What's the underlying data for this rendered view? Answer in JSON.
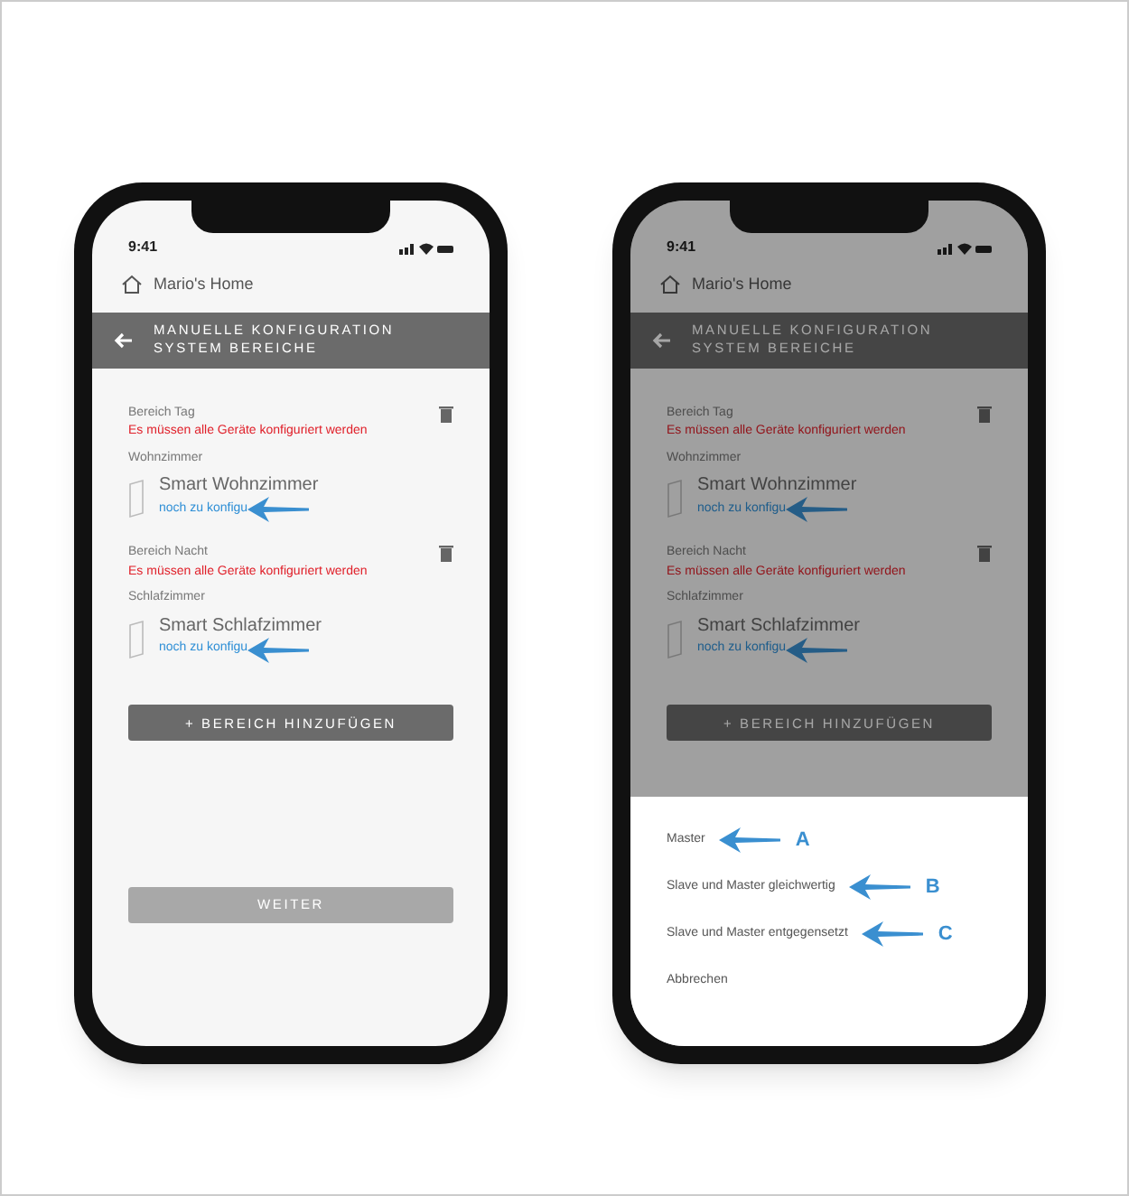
{
  "phones": [
    {
      "time": "9:41",
      "home": "Mario's Home",
      "header": [
        "MANUELLE KONFIGURATION",
        "SYSTEM BEREICHE"
      ],
      "dimmed": false,
      "areas": [
        {
          "label": "Bereich Tag",
          "error": "Es müssen alle Geräte konfiguriert werden",
          "room": "Wohnzimmer",
          "device": "Smart Wohnzimmer",
          "link": "noch zu konfigu",
          "arrow": true
        },
        {
          "label": "Bereich Nacht",
          "error": "Es müssen alle Geräte konfiguriert werden",
          "room": "Schlafzimmer",
          "device": "Smart Schlafzimmer",
          "link": "noch zu konfigu",
          "arrow": true
        }
      ],
      "add_button": "+ BEREICH HINZUFÜGEN",
      "next_button": {
        "label": "WEITER",
        "disabled": true
      }
    },
    {
      "time": "9:41",
      "home": "Mario's Home",
      "header": [
        "MANUELLE KONFIGURATION",
        "SYSTEM BEREICHE"
      ],
      "dimmed": true,
      "areas": [
        {
          "label": "Bereich Tag",
          "error": "Es müssen alle Geräte konfiguriert werden",
          "room": "Wohnzimmer",
          "device": "Smart Wohnzimmer",
          "link": "noch zu konfigu",
          "arrow": true
        },
        {
          "label": "Bereich Nacht",
          "error": "Es müssen alle Geräte konfiguriert werden",
          "room": "Schlafzimmer",
          "device": "Smart Schlafzimmer",
          "link": "noch zu konfigu",
          "arrow": true
        }
      ],
      "add_button": "+ BEREICH HINZUFÜGEN",
      "sheet": [
        {
          "label": "Master",
          "marker": "A"
        },
        {
          "label": "Slave und Master gleichwertig",
          "marker": "B"
        },
        {
          "label": "Slave und Master entgegensetzt",
          "marker": "C"
        },
        {
          "label": "Abbrechen"
        }
      ]
    }
  ]
}
